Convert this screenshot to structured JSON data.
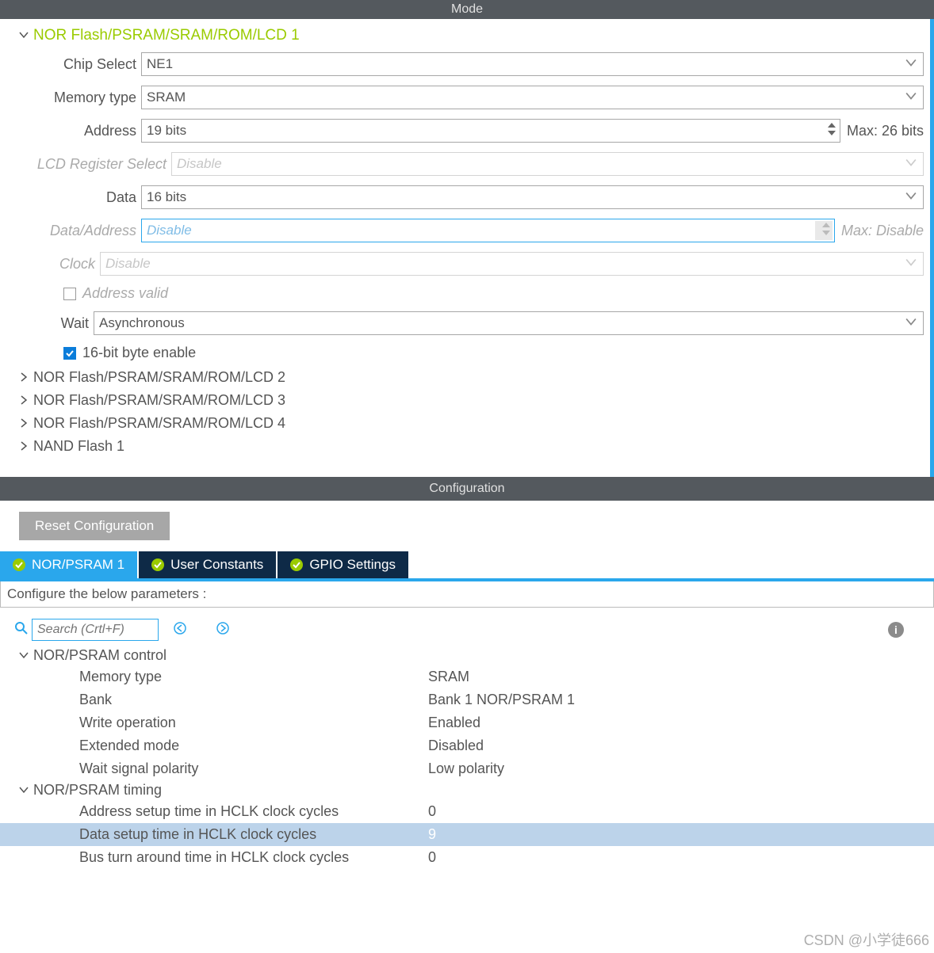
{
  "header_mode": "Mode",
  "mode": {
    "title": "NOR Flash/PSRAM/SRAM/ROM/LCD 1",
    "fields": {
      "chip_select": {
        "label": "Chip Select",
        "value": "NE1"
      },
      "memory_type": {
        "label": "Memory type",
        "value": "SRAM"
      },
      "address": {
        "label": "Address",
        "value": "19 bits",
        "after": "Max: 26 bits"
      },
      "lcd_reg": {
        "label": "LCD Register Select",
        "value": "Disable"
      },
      "data": {
        "label": "Data",
        "value": "16 bits"
      },
      "data_addr": {
        "label": "Data/Address",
        "value": "Disable",
        "after": "Max: Disable"
      },
      "clock": {
        "label": "Clock",
        "value": "Disable"
      },
      "addr_valid": {
        "label": "Address valid",
        "checked": false
      },
      "wait": {
        "label": "Wait",
        "value": "Asynchronous"
      },
      "byte_enable": {
        "label": "16-bit byte enable",
        "checked": true
      }
    },
    "collapsed": [
      "NOR Flash/PSRAM/SRAM/ROM/LCD 2",
      "NOR Flash/PSRAM/SRAM/ROM/LCD 3",
      "NOR Flash/PSRAM/SRAM/ROM/LCD 4",
      "NAND Flash 1"
    ]
  },
  "header_config": "Configuration",
  "reset_btn": "Reset Configuration",
  "tabs": [
    "NOR/PSRAM 1",
    "User Constants",
    "GPIO Settings"
  ],
  "configure_text": "Configure the below parameters :",
  "search_placeholder": "Search (Crtl+F)",
  "groups": [
    {
      "name": "NOR/PSRAM control",
      "rows": [
        {
          "label": "Memory type",
          "value": "SRAM"
        },
        {
          "label": "Bank",
          "value": "Bank 1 NOR/PSRAM 1"
        },
        {
          "label": "Write operation",
          "value": "Enabled"
        },
        {
          "label": "Extended mode",
          "value": "Disabled"
        },
        {
          "label": "Wait signal polarity",
          "value": "Low polarity"
        }
      ]
    },
    {
      "name": "NOR/PSRAM timing",
      "rows": [
        {
          "label": "Address setup time in HCLK clock cycles",
          "value": "0"
        },
        {
          "label": "Data setup time in HCLK clock cycles",
          "value": "9",
          "selected": true
        },
        {
          "label": "Bus turn around time in HCLK clock cycles",
          "value": "0"
        }
      ]
    }
  ],
  "watermark": "CSDN @小学徒666"
}
